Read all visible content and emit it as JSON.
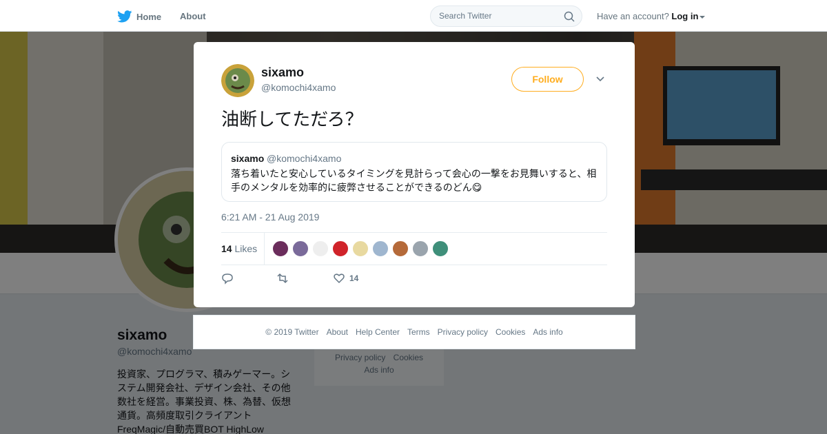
{
  "nav": {
    "home_label": "Home",
    "about_label": "About",
    "search_placeholder": "Search Twitter",
    "have_account": "Have an account?",
    "login_label": "Log in"
  },
  "profile": {
    "name": "sixamo",
    "handle": "@komochi4xamo",
    "bio_lines": [
      "投資家、プログラマ、積みゲーマー。シ",
      "ステム開発会社、デザイン会社、その他",
      "数社を経営。事業投資、株、為替、仮想",
      "通貨。高頻度取引クライアント",
      "FreqMagic/自動売買BOT HighLow"
    ],
    "side_links": [
      "Privacy policy",
      "Cookies",
      "Ads info"
    ]
  },
  "tweet": {
    "name": "sixamo",
    "handle": "@komochi4xamo",
    "follow_label": "Follow",
    "text": "油断してただろ？",
    "quote": {
      "name": "sixamo",
      "handle": "@komochi4xamo",
      "text": "落ち着いたと安心しているタイミングを見計らって会心の一撃をお見舞いすると、相手のメンタルを効率的に疲弊させることができるのどん😋"
    },
    "timestamp": "6:21 AM - 21 Aug 2019",
    "likes_count": "14",
    "likes_label": "Likes",
    "like_action_count": "14",
    "liker_colors": [
      "#6b2d5c",
      "#7a6a9a",
      "#eeeeee",
      "#d0232a",
      "#e8d9a0",
      "#9fb6cf",
      "#b56a3a",
      "#9aa4ad",
      "#3f8f7a"
    ]
  },
  "footer": {
    "links": [
      "© 2019 Twitter",
      "About",
      "Help Center",
      "Terms",
      "Privacy policy",
      "Cookies",
      "Ads info"
    ]
  },
  "colors": {
    "brand": "#1da1f2",
    "follow": "#ffad1f"
  }
}
